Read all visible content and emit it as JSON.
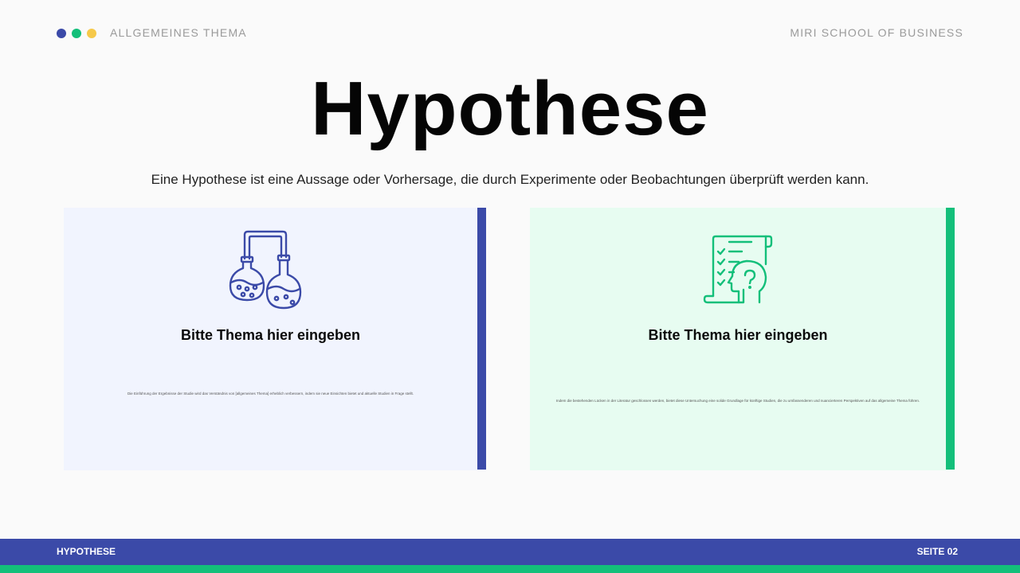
{
  "colors": {
    "dot_blue": "#3b4aa8",
    "dot_green": "#13bf7a",
    "dot_yellow": "#f6c94a",
    "accent_blue": "#3b4aa8",
    "accent_green": "#13bf7a"
  },
  "header": {
    "left_label": "ALLGEMEINES THEMA",
    "right_label": "MIRI SCHOOL OF BUSINESS"
  },
  "title": "Hypothese",
  "subtitle": "Eine Hypothese ist eine Aussage oder Vorhersage, die durch Experimente oder Beobachtungen überprüft werden kann.",
  "cards": [
    {
      "icon": "flasks-icon",
      "title": "Bitte Thema hier eingeben",
      "text": "Die Einführung der Ergebnisse der Studie wird das Verständnis von [allgemeines Thema] erheblich verbessern, indem sie neue Einsichten bietet und aktuelle Studien in Frage stellt."
    },
    {
      "icon": "checklist-head-question-icon",
      "title": "Bitte Thema hier eingeben",
      "text": "Indem die bestehenden Lücken in der Literatur geschlossen werden, bietet diese Untersuchung eine solide Grundlage für künftige Studien, die zu umfassenderen und nuancierteren Perspektiven auf das allgemeine Thema führen."
    }
  ],
  "footer": {
    "left_label": "HYPOTHESE",
    "right_label": "SEITE 02"
  }
}
